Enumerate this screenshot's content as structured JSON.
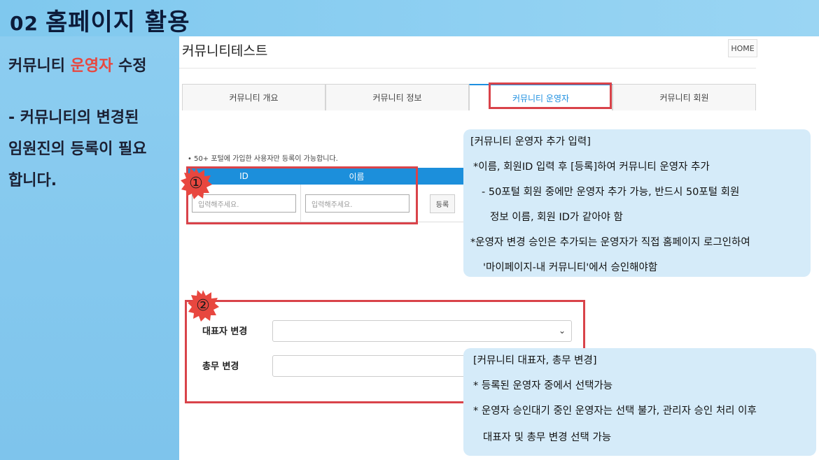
{
  "slide": {
    "number": "02",
    "title": "홈페이지 활용"
  },
  "sidebar": {
    "heading_pre": "커뮤니티 ",
    "heading_highlight": "운영자",
    "heading_post": " 수정",
    "desc_lines": [
      "- 커뮤니티의 변경된",
      "임원진의 등록이 필요",
      "합니다."
    ]
  },
  "page": {
    "title": "커뮤니티테스트",
    "home_label": "HOME",
    "tabs": [
      {
        "label": "커뮤니티 개요"
      },
      {
        "label": "커뮤니티 정보"
      },
      {
        "label": "커뮤니티 운영자",
        "active": true
      },
      {
        "label": "커뮤니티 회원"
      }
    ],
    "note": "• 50+ 포털에 가입한 사용자만 등록이 가능합니다.",
    "table": {
      "col_id": "ID",
      "col_name": "이름",
      "id_placeholder": "입력해주세요.",
      "name_placeholder": "입력해주세요.",
      "register_label": "등록"
    },
    "form": {
      "rep_label": "대표자 변경",
      "sec_label": "총무 변경",
      "rep_value": ""
    }
  },
  "badges": [
    "①",
    "②"
  ],
  "callout1": {
    "lines": [
      "[커뮤니티 운영자 추가 입력]",
      "*이름, 회원ID 입력 후 [등록]하여 커뮤니티 운영자 추가",
      "- 50포털 회원 중에만 운영자 추가 가능, 반드시  50포털 회원",
      "정보  이름,  회원 ID가 같아야 함",
      "*운영자 변경 승인은 추가되는 운영자가 직접 홈페이지 로그인하여",
      "'마이페이지-내 커뮤니티'에서 승인해야함"
    ]
  },
  "callout2": {
    "lines": [
      "[커뮤니티 대표자, 총무 변경]",
      "* 등록된 운영자 중에서 선택가능",
      "* 운영자 승인대기 중인 운영자는 선택 불가, 관리자 승인 처리 이후",
      "대표자 및 총무 변경 선택 가능"
    ]
  },
  "colors": {
    "accent_red": "#d9434a",
    "tab_blue": "#1e8fe0",
    "header_blue": "#1c8fdb",
    "callout_bg": "#d5ebf9",
    "badge_red": "#e8473f"
  }
}
